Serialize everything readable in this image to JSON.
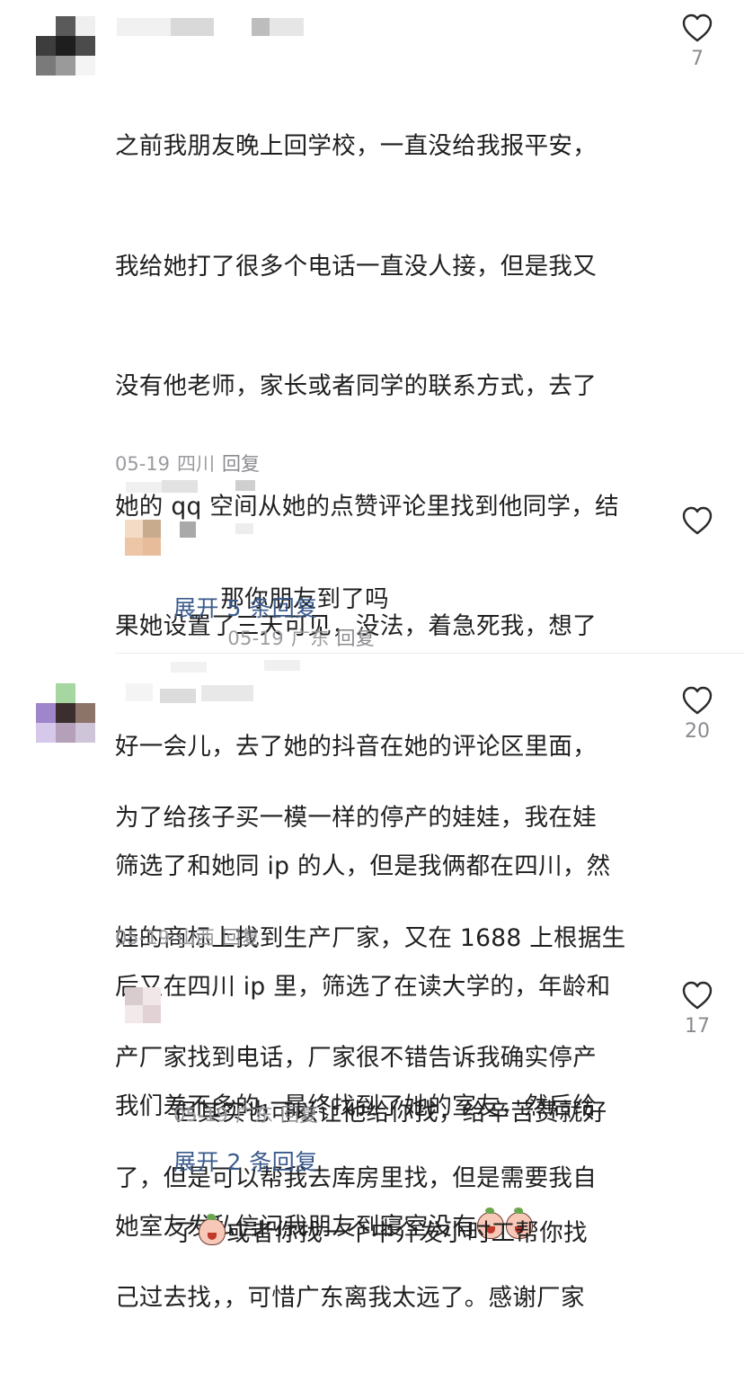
{
  "comments": [
    {
      "body_lines": [
        "之前我朋友晚上回学校，一直没给我报平安，",
        "我给她打了很多个电话一直没人接，但是我又",
        "没有他老师，家长或者同学的联系方式，去了",
        "她的 qq 空间从她的点赞评论里找到他同学，结",
        "果她设置了三天可见，没法，着急死我，想了",
        "好一会儿，去了她的抖音在她的评论区里面，",
        "筛选了和她同 ip 的人，但是我俩都在四川，然",
        "后又在四川 ip 里，筛选了在读大学的，年龄和",
        "我们差不多的，最终找到了她的室友，然后给",
        "她室友发私信问我朋友到寝室没有"
      ],
      "date": "05-19",
      "location": "四川",
      "reply_label": "回复",
      "likes": "7",
      "reply": {
        "text": "那你朋友到了吗",
        "date": "05-19",
        "location": "广东",
        "reply_label": "回复"
      },
      "expand_label": "展开 5 条回复"
    },
    {
      "body_lines": [
        "为了给孩子买一模一样的停产的娃娃，我在娃",
        "娃的商标上找到生产厂家，又在 1688 上根据生",
        "产厂家找到电话，厂家很不错告诉我确实停产",
        "了，但是可以帮我去库房里找，但是需要我自",
        "己过去找，，可惜广东离我太远了。感谢厂家"
      ],
      "date": "05-19",
      "location": "山西",
      "reply_label": "回复",
      "likes": "20",
      "reply": {
        "line1": "但其实也可以让他给你找，给辛苦费就好",
        "line2_prefix": "了",
        "line2_suffix": "或者你找一个中介发小时工帮你找",
        "date": "05-19",
        "location": "广东",
        "reply_label": "回复",
        "likes": "17"
      },
      "expand_label": "展开 2 条回复"
    }
  ],
  "icons": {
    "like": "heart-outline-icon",
    "emoji": "crying-peach-emoji-icon"
  },
  "colors": {
    "text": "#1f1f1f",
    "meta": "#9b9ba0",
    "expand_link": "#3a5a8c",
    "heart_stroke": "#2a2a2a"
  }
}
